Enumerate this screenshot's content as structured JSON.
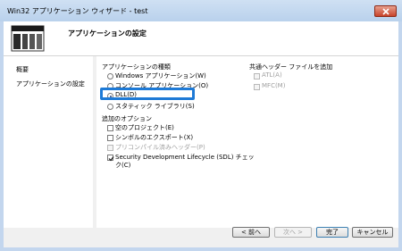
{
  "window": {
    "title": "Win32 アプリケーション ウィザード - test"
  },
  "header": {
    "title": "アプリケーションの設定"
  },
  "nav": {
    "items": [
      "概要",
      "アプリケーションの設定"
    ]
  },
  "app_type": {
    "title": "アプリケーションの種類",
    "options": [
      "Windows アプリケーション(W)",
      "コンソール アプリケーション(O)",
      "DLL(D)",
      "スタティック ライブラリ(S)"
    ],
    "selected": "DLL(D)"
  },
  "additional": {
    "title": "追加のオプション",
    "options": [
      "空のプロジェクト(E)",
      "シンボルのエクスポート(X)",
      "プリコンパイル済みヘッダー(P)",
      "Security Development Lifecycle (SDL) チェッ",
      "ク(C)"
    ]
  },
  "common_headers": {
    "title": "共通ヘッダー ファイルを追加",
    "options": [
      "ATL(A)",
      "MFC(M)"
    ]
  },
  "buttons": {
    "prev": "< 前へ",
    "next": "次へ >",
    "finish": "完了",
    "cancel": "キャンセル"
  }
}
